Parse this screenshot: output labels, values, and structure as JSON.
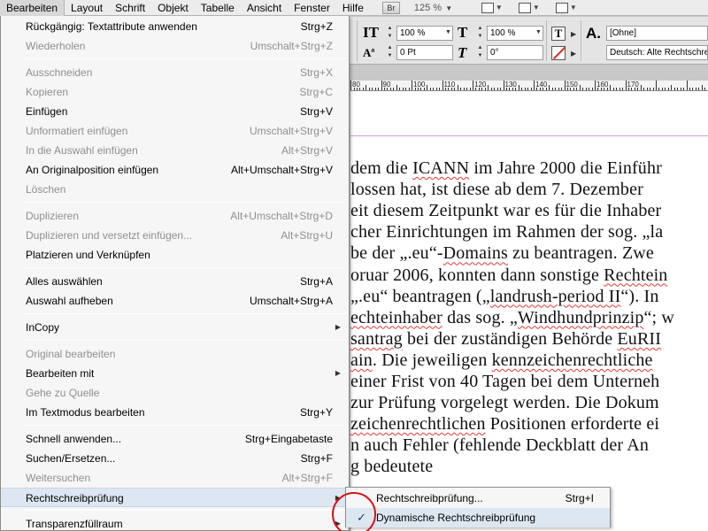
{
  "menubar": {
    "items": [
      {
        "label": "Bearbeiten",
        "active": true
      },
      {
        "label": "Layout"
      },
      {
        "label": "Schrift"
      },
      {
        "label": "Objekt"
      },
      {
        "label": "Tabelle"
      },
      {
        "label": "Ansicht"
      },
      {
        "label": "Fenster"
      },
      {
        "label": "Hilfe"
      }
    ],
    "bridge_label": "Br",
    "zoom": "125 %"
  },
  "control_panel": {
    "vscale": "100 %",
    "hscale": "100 %",
    "baseline": "0 Pt",
    "skew": "0°",
    "char_style": "[Ohne]",
    "language": "Deutsch: Alte Rechtschreib"
  },
  "ruler": {
    "labels": [
      "80",
      "90",
      "100",
      "110",
      "120",
      "130",
      "140",
      "150",
      "160",
      "170"
    ]
  },
  "document": {
    "lines": [
      [
        {
          "t": "dem die "
        },
        {
          "t": "ICANN",
          "sp": true
        },
        {
          "t": " im Jahre 2000 die Einführ"
        }
      ],
      [
        {
          "t": "lossen hat, ist diese ab dem 7. Dezember"
        }
      ],
      [
        {
          "t": "eit diesem Zeitpunkt war es für die Inhaber"
        }
      ],
      [
        {
          "t": "cher Einrichtungen im Rahmen der sog. „la"
        }
      ],
      [
        {
          "t": "be der „.eu“-"
        },
        {
          "t": "Domains",
          "sp": true
        },
        {
          "t": " zu beantragen. Zwe"
        }
      ],
      [
        {
          "t": "oruar 2006, konnten dann sonstige "
        },
        {
          "t": "Rechtein",
          "sp": true
        }
      ],
      [
        {
          "t": "„.eu“ beantragen („"
        },
        {
          "t": "landrush-period II",
          "sp": true
        },
        {
          "t": "“). In"
        }
      ],
      [
        {
          "t": "echteinhaber",
          "sp": true
        },
        {
          "t": " das sog. „"
        },
        {
          "t": "Windhundprinzip",
          "sp": true
        },
        {
          "t": "“; w"
        }
      ],
      [
        {
          "t": "santrag",
          "sp": true
        },
        {
          "t": " bei der zuständigen Behörde "
        },
        {
          "t": "EuRII",
          "sp": true
        }
      ],
      [
        {
          "t": "ain",
          "sp": true
        },
        {
          "t": ". Die jeweiligen "
        },
        {
          "t": "kennzeichenrechtliche",
          "sp": true
        }
      ],
      [
        {
          "t": "einer Frist von 40 Tagen bei dem Unterneh"
        }
      ],
      [
        {
          "t": "zur Prüfung vorgelegt werden. Die Dokum"
        }
      ],
      [
        {
          "t": "zeichenrechtlichen",
          "sp": true
        },
        {
          "t": " Positionen erforderte ei"
        }
      ],
      [
        {
          "t": "n auch Fehler (fehlende Deckblatt der An"
        }
      ],
      [
        {
          "t": "g bedeutete"
        }
      ]
    ]
  },
  "edit_menu": {
    "items": [
      {
        "label": "Rückgängig: Textattribute anwenden",
        "shortcut": "Strg+Z"
      },
      {
        "label": "Wiederholen",
        "shortcut": "Umschalt+Strg+Z",
        "disabled": true
      },
      {
        "sep": true
      },
      {
        "label": "Ausschneiden",
        "shortcut": "Strg+X",
        "disabled": true
      },
      {
        "label": "Kopieren",
        "shortcut": "Strg+C",
        "disabled": true
      },
      {
        "label": "Einfügen",
        "shortcut": "Strg+V"
      },
      {
        "label": "Unformatiert einfügen",
        "shortcut": "Umschalt+Strg+V",
        "disabled": true
      },
      {
        "label": "In die Auswahl einfügen",
        "shortcut": "Alt+Strg+V",
        "disabled": true
      },
      {
        "label": "An Originalposition einfügen",
        "shortcut": "Alt+Umschalt+Strg+V"
      },
      {
        "label": "Löschen",
        "shortcut": "",
        "disabled": true
      },
      {
        "sep": true
      },
      {
        "label": "Duplizieren",
        "shortcut": "Alt+Umschalt+Strg+D",
        "disabled": true
      },
      {
        "label": "Duplizieren und versetzt einfügen...",
        "shortcut": "Alt+Strg+U",
        "disabled": true
      },
      {
        "label": "Platzieren und Verknüpfen",
        "shortcut": ""
      },
      {
        "sep": true
      },
      {
        "label": "Alles auswählen",
        "shortcut": "Strg+A"
      },
      {
        "label": "Auswahl aufheben",
        "shortcut": "Umschalt+Strg+A"
      },
      {
        "sep": true
      },
      {
        "label": "InCopy",
        "shortcut": "",
        "submenu": true
      },
      {
        "sep": true
      },
      {
        "label": "Original bearbeiten",
        "shortcut": "",
        "disabled": true
      },
      {
        "label": "Bearbeiten mit",
        "shortcut": "",
        "submenu": true
      },
      {
        "label": "Gehe zu Quelle",
        "shortcut": "",
        "disabled": true
      },
      {
        "label": "Im Textmodus bearbeiten",
        "shortcut": "Strg+Y"
      },
      {
        "sep": true
      },
      {
        "label": "Schnell anwenden...",
        "shortcut": "Strg+Eingabetaste"
      },
      {
        "label": "Suchen/Ersetzen...",
        "shortcut": "Strg+F"
      },
      {
        "label": "Weitersuchen",
        "shortcut": "Alt+Strg+F",
        "disabled": true
      },
      {
        "label": "Rechtschreibprüfung",
        "shortcut": "",
        "submenu": true,
        "highlighted": true
      },
      {
        "sep": true
      },
      {
        "label": "Transparenzfüllraum",
        "shortcut": "",
        "submenu": true
      }
    ]
  },
  "spelling_submenu": {
    "items": [
      {
        "label": "Rechtschreibprüfung...",
        "shortcut": "Strg+I"
      },
      {
        "label": "Dynamische Rechtschreibprüfung",
        "shortcut": "",
        "checked": true,
        "highlighted": true
      }
    ]
  },
  "colors": {
    "menu_highlight": "#dde7f2",
    "disabled_text": "#8f8f8f",
    "annotation_red": "#d41313",
    "spelling_underline": "#e03a3a"
  },
  "icons": {
    "check": "✓",
    "submenu": "▶",
    "dropdown": "▼"
  }
}
